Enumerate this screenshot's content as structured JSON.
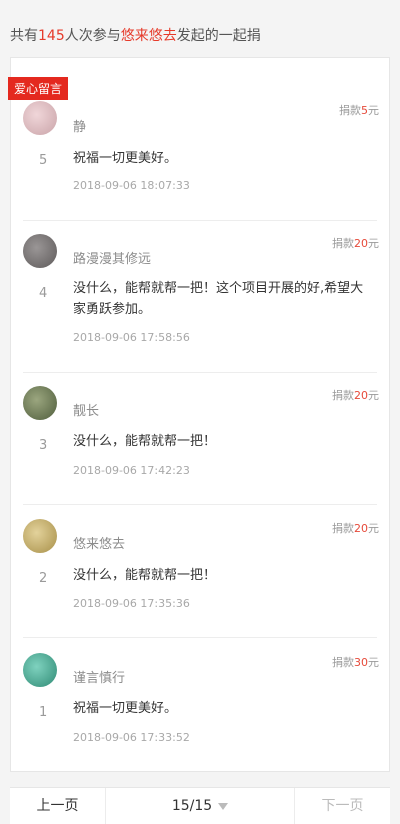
{
  "summary": {
    "prefix": "共有",
    "count": "145",
    "middle": "人次参与",
    "organizer": "悠来悠去",
    "suffix": "发起的一起捐"
  },
  "card": {
    "tag": "爱心留言",
    "amount_label": "捐款",
    "amount_unit": "元",
    "entries": [
      {
        "num": "5",
        "name": "静",
        "message": "祝福一切更美好。",
        "time": "2018-09-06 18:07:33",
        "amount": "5",
        "avatar_color": "#c9a3a8"
      },
      {
        "num": "4",
        "name": "路漫漫其修远",
        "message": "没什么，能帮就帮一把！这个项目开展的好,希望大家勇跃参加。",
        "time": "2018-09-06 17:58:56",
        "amount": "20",
        "avatar_color": "#6e6a6a"
      },
      {
        "num": "3",
        "name": "靓长",
        "message": "没什么，能帮就帮一把！",
        "time": "2018-09-06 17:42:23",
        "amount": "20",
        "avatar_color": "#6f7d58"
      },
      {
        "num": "2",
        "name": "悠来悠去",
        "message": "没什么，能帮就帮一把！",
        "time": "2018-09-06 17:35:36",
        "amount": "20",
        "avatar_color": "#b9a35c"
      },
      {
        "num": "1",
        "name": "谨言慎行",
        "message": "祝福一切更美好。",
        "time": "2018-09-06 17:33:52",
        "amount": "30",
        "avatar_color": "#3f9f87"
      }
    ]
  },
  "pager": {
    "prev": "上一页",
    "page": "15/15",
    "next": "下一页"
  }
}
